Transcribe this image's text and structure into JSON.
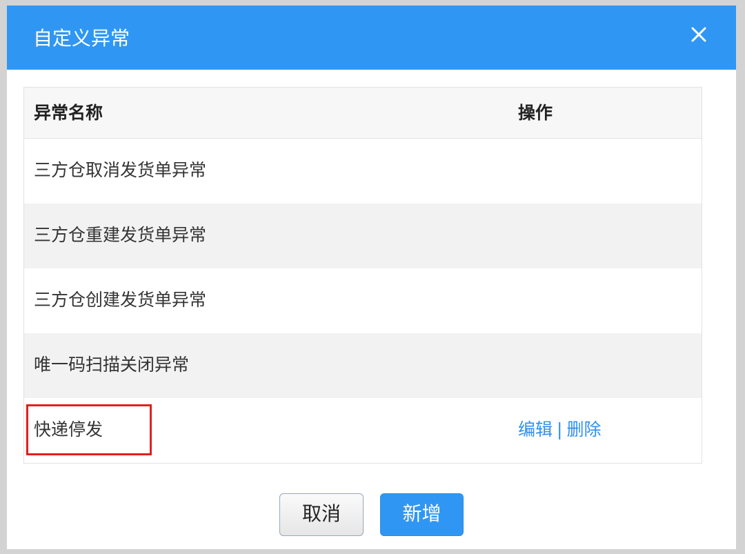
{
  "dialog": {
    "title": "自定义异常",
    "close_icon": "close-icon"
  },
  "table": {
    "headers": {
      "name": "异常名称",
      "operation": "操作"
    },
    "rows": [
      {
        "name": "三方仓取消发货单异常",
        "edit": "",
        "sep": "",
        "delete": ""
      },
      {
        "name": "三方仓重建发货单异常",
        "edit": "",
        "sep": "",
        "delete": ""
      },
      {
        "name": "三方仓创建发货单异常",
        "edit": "",
        "sep": "",
        "delete": ""
      },
      {
        "name": "唯一码扫描关闭异常",
        "edit": "",
        "sep": "",
        "delete": ""
      },
      {
        "name": "快递停发",
        "edit": "编辑",
        "sep": "|",
        "delete": "删除"
      }
    ]
  },
  "buttons": {
    "cancel": "取消",
    "add": "新增"
  },
  "colors": {
    "header_bg": "#2f97f3",
    "link": "#2f8ff0",
    "highlight": "#e51d1d"
  }
}
